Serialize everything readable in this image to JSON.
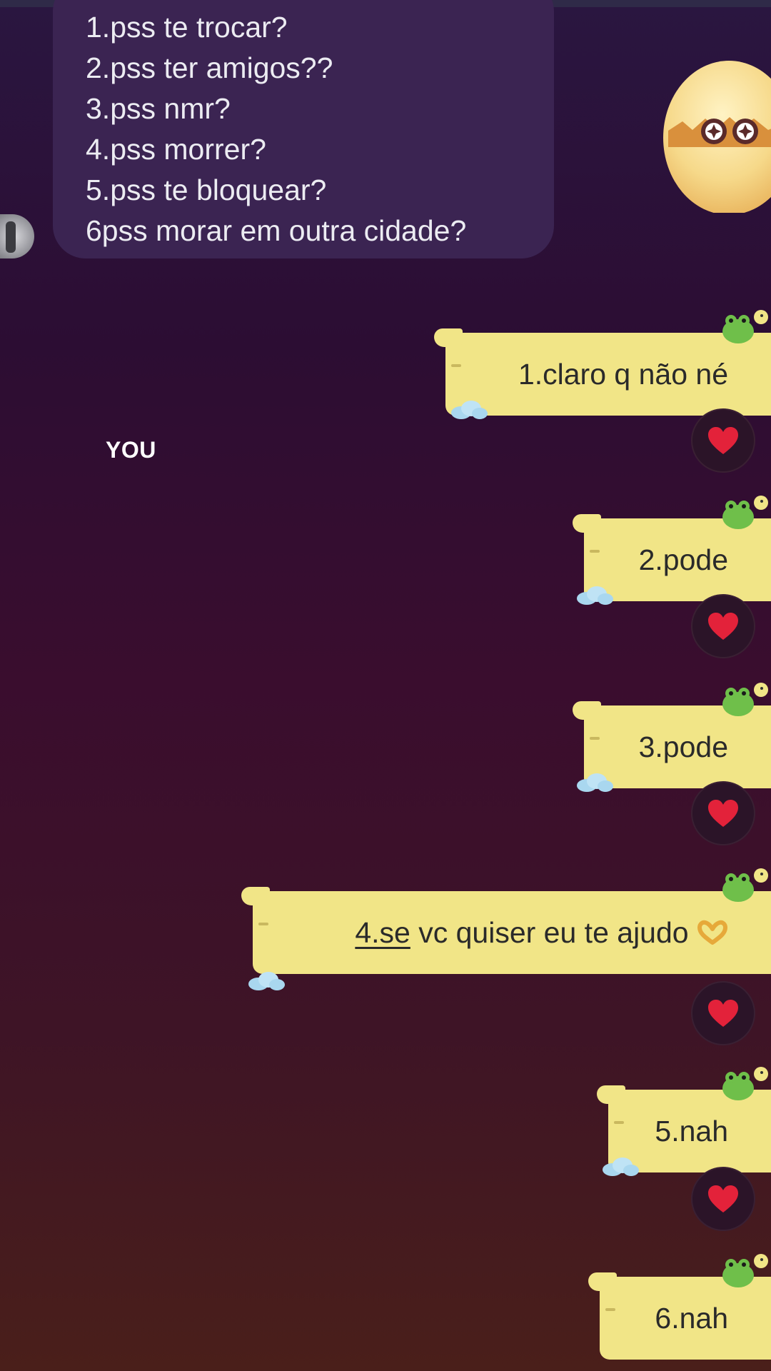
{
  "incoming": {
    "lines": [
      "1.pss te trocar?",
      "2.pss ter amigos??",
      "3.pss nmr?",
      "4.pss morrer?",
      "5.pss te bloquear?",
      "6pss morar em outra cidade?"
    ]
  },
  "label": "YOU",
  "outgoing": [
    {
      "text": "1.claro q não né",
      "reaction": "heart"
    },
    {
      "text": "2.pode",
      "reaction": "heart"
    },
    {
      "text": "3.pode",
      "reaction": "heart"
    },
    {
      "text_prefix": "4.se",
      "text_rest": " vc quiser eu te ajudo",
      "emoji": "heart-hands",
      "reaction": "heart"
    },
    {
      "text": "5.nah",
      "reaction": "heart"
    },
    {
      "text": "6.nah"
    }
  ],
  "colors": {
    "incoming_bubble": "#3b2452",
    "outgoing_bubble": "#f1e587",
    "heart": "#e3223a"
  }
}
